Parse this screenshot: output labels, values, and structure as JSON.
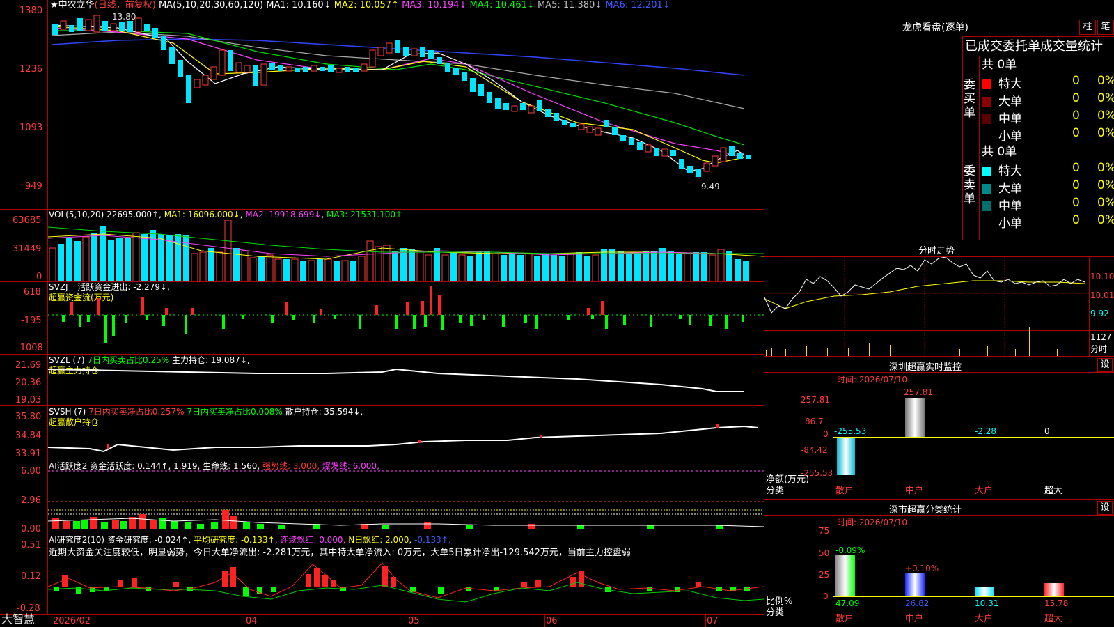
{
  "stock": {
    "name": "★中农立华",
    "mode": "(日线，前复权)",
    "ma_label": "MA(5,10,20,30,60,120)",
    "ma1": "MA1: 10.160↓",
    "ma2": "MA2: 10.057↑",
    "ma3": "MA3: 10.194↓",
    "ma4": "MA4: 10.461↓",
    "ma5": "MA5: 11.380↓",
    "ma6": "MA6: 12.201↓",
    "high_mark": "13.80",
    "low_mark": "9.49",
    "y_ticks": [
      "1380",
      "1236",
      "1093",
      "949"
    ]
  },
  "vol": {
    "label": "VOL(5,10,20)",
    "value": "22695.000↑",
    "ma1": "MA1: 16096.000↓",
    "ma2": "MA2: 19918.699↓",
    "ma3": "MA3: 21531.100↑",
    "y_ticks": [
      "63685",
      "31449",
      "0"
    ]
  },
  "svzj": {
    "label": "SVZJ",
    "desc": "活跃资金进出: -2.279↓,",
    "sub": "超赢资金流(万元)",
    "y_ticks": [
      "618",
      "-195",
      "-1008"
    ]
  },
  "svzl": {
    "label": "SVZL (7)",
    "ratio": "7日内买卖占比0.25%",
    "hold": "主力持仓: 19.087↓,",
    "sub": "超赢主力持仓",
    "y_ticks": [
      "21.69",
      "20.36",
      "19.03"
    ]
  },
  "svsh": {
    "label": "SVSH (7)",
    "ratio1": "7日内买卖净占比0.257%",
    "ratio2": "7日内买卖净占比0.008%",
    "hold": "散户持仓: 35.594↓,",
    "sub": "超赢散户持仓",
    "y_ticks": [
      "35.80",
      "34.84",
      "33.91"
    ]
  },
  "ai_active": {
    "label": "AI活跃度2",
    "fund": "资金活跃度: 0.144↑,",
    "v2": "1.919,",
    "life": "生命线: 1.560,",
    "strong": "强势线: 3.000,",
    "burst": "爆发线: 6.000,",
    "y_ticks": [
      "6.00",
      "2.96",
      "0.00"
    ]
  },
  "ai_research": {
    "label": "AI研究度2(10)",
    "fund": "资金研究度: -0.024↑,",
    "avg": "平均研究度: -0.133↑,",
    "streak": "连续飘红: 0.000,",
    "nday": "N日飘红: 2.000,",
    "last": "-0.133↑,",
    "summary": "近期大资金关注度较低，明显弱势，今日大单净流出: -2.281万元，其中特大单净流入: 0万元，大单5日累计净出-129.542万元，当前主力控盘弱",
    "y_ticks": [
      "0.51",
      "0.12",
      "-0.28"
    ]
  },
  "x_axis": {
    "labels": [
      "2026/02",
      "04",
      "05",
      "06",
      "07"
    ],
    "brand": "大智慧"
  },
  "lhb": {
    "title": "龙虎看盘(逐单)",
    "btn_bar": "柱",
    "btn_pen": "笔",
    "header": "已成交委托单成交量统计",
    "buy_side": "委买单",
    "sell_side": "委卖单",
    "buy_total": "共 0单",
    "sell_total": "共 0单",
    "buy_rows": [
      {
        "label": "特大",
        "v": "0",
        "p": "0%"
      },
      {
        "label": "大单",
        "v": "0",
        "p": "0%"
      },
      {
        "label": "中单",
        "v": "0",
        "p": "0%"
      },
      {
        "label": "小单",
        "v": "0",
        "p": "0%"
      }
    ],
    "sell_rows": [
      {
        "label": "特大",
        "v": "0",
        "p": "0%"
      },
      {
        "label": "大单",
        "v": "0",
        "p": "0%"
      },
      {
        "label": "中单",
        "v": "0",
        "p": "0%"
      },
      {
        "label": "小单",
        "v": "0",
        "p": "0%"
      }
    ]
  },
  "intraday": {
    "title": "分时走势",
    "y_ticks": [
      "10.10",
      "10.01",
      "9.92"
    ],
    "vol_tick": "1127",
    "unit": "分时"
  },
  "sz_monitor": {
    "title": "深圳超赢实时监控",
    "btn": "设",
    "time": "时间: 2026/07/10",
    "top_label": "257.81",
    "y_ticks": [
      "257.81",
      "86.7",
      "0",
      "-84.42",
      "-255.53"
    ],
    "values": [
      "-255.53",
      "",
      "-2.28",
      "0"
    ],
    "unit1": "净额(万元)",
    "unit2": "分类",
    "cats": [
      "散户",
      "中户",
      "大户",
      "超大"
    ]
  },
  "sz_stats": {
    "title": "深市超赢分类统计",
    "btn": "设",
    "time": "时间: 2026/07/10",
    "y_ticks": [
      "75",
      "50",
      "25",
      "0"
    ],
    "tops": [
      "-0.09%",
      "+0.10%"
    ],
    "values": [
      "47.09",
      "26.82",
      "10.31",
      "15.78"
    ],
    "unit1": "比例%",
    "unit2": "分类",
    "cats": [
      "散户",
      "中户",
      "大户",
      "超大"
    ]
  }
}
